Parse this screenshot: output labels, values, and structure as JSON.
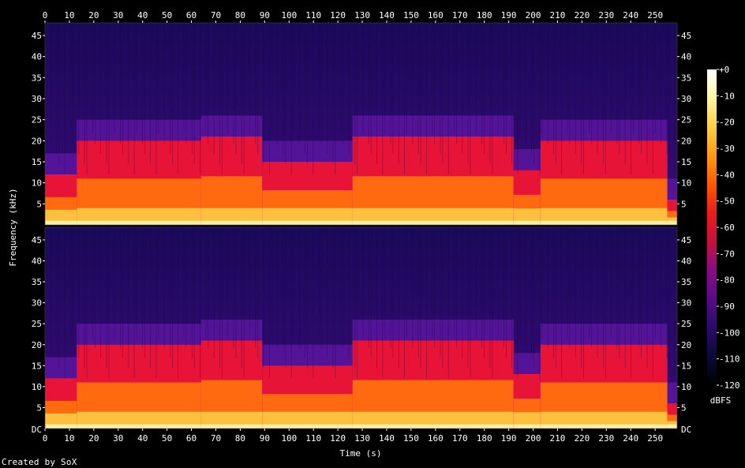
{
  "chart_data": {
    "type": "heatmap",
    "title": "",
    "xlabel": "Time (s)",
    "ylabel": "Frequency (kHz)",
    "x_ticks": [
      0,
      10,
      20,
      30,
      40,
      50,
      60,
      70,
      80,
      90,
      100,
      110,
      120,
      130,
      140,
      150,
      160,
      170,
      180,
      190,
      200,
      210,
      220,
      230,
      240,
      250
    ],
    "xlim": [
      0,
      259
    ],
    "y_ticks": [
      5,
      10,
      15,
      20,
      25,
      30,
      35,
      40,
      45
    ],
    "y_tick_labels": [
      "5",
      "10",
      "15",
      "20",
      "25",
      "30",
      "35",
      "40",
      "45"
    ],
    "ylim": [
      0,
      48
    ],
    "dc_label": "DC",
    "channels": [
      "left",
      "right"
    ],
    "colorbar": {
      "label": "dBFS",
      "ticks": [
        "+0",
        "-10",
        "-20",
        "-30",
        "-40",
        "-50",
        "-60",
        "-70",
        "-80",
        "-90",
        "-100",
        "-110",
        "-120"
      ],
      "range": [
        -120,
        0
      ],
      "colors": [
        "#000000",
        "#0a0a3a",
        "#2a0a6e",
        "#5a0a8a",
        "#8a0a8a",
        "#c8103c",
        "#f01a1a",
        "#ff5a00",
        "#ff9a10",
        "#ffd040",
        "#fff5a0",
        "#ffffff"
      ]
    },
    "segments": [
      {
        "t_start": 0,
        "t_end": 13,
        "cutoff_khz": 12
      },
      {
        "t_start": 13,
        "t_end": 64,
        "cutoff_khz": 20
      },
      {
        "t_start": 64,
        "t_end": 89,
        "cutoff_khz": 21
      },
      {
        "t_start": 89,
        "t_end": 126,
        "cutoff_khz": 15
      },
      {
        "t_start": 126,
        "t_end": 192,
        "cutoff_khz": 21
      },
      {
        "t_start": 192,
        "t_end": 203,
        "cutoff_khz": 13
      },
      {
        "t_start": 203,
        "t_end": 255,
        "cutoff_khz": 20
      },
      {
        "t_start": 255,
        "t_end": 259,
        "cutoff_khz": 6
      }
    ]
  },
  "footer": {
    "credit": "Created by SoX"
  }
}
